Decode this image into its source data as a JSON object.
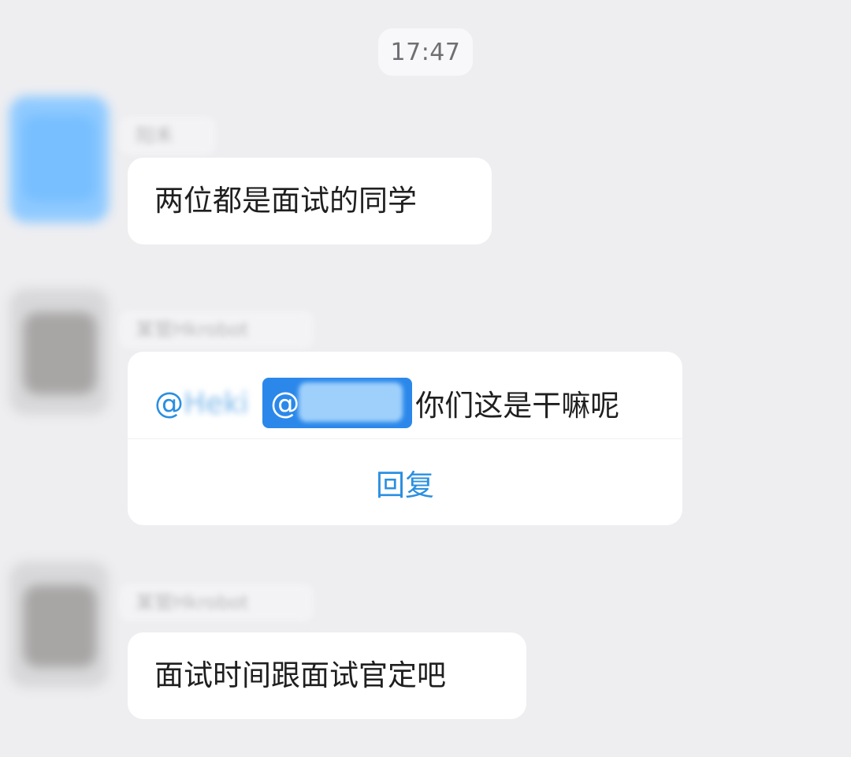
{
  "timestamp": "17:47",
  "messages": [
    {
      "sender": "阳禾",
      "text": "两位都是面试的同学"
    },
    {
      "sender": "某管Hkrobot",
      "mention_1": "@",
      "mention_1_name": "Heki",
      "mention_2": "@",
      "text": "你们这是干嘛呢",
      "reply_label": "回复"
    },
    {
      "sender": "某管Hkrobot",
      "text": "面试时间跟面试官定吧"
    }
  ],
  "colors": {
    "background": "#eeeef1",
    "bubble": "#ffffff",
    "accent": "#2a8fe0",
    "mention_highlight": "#2b88ea"
  }
}
